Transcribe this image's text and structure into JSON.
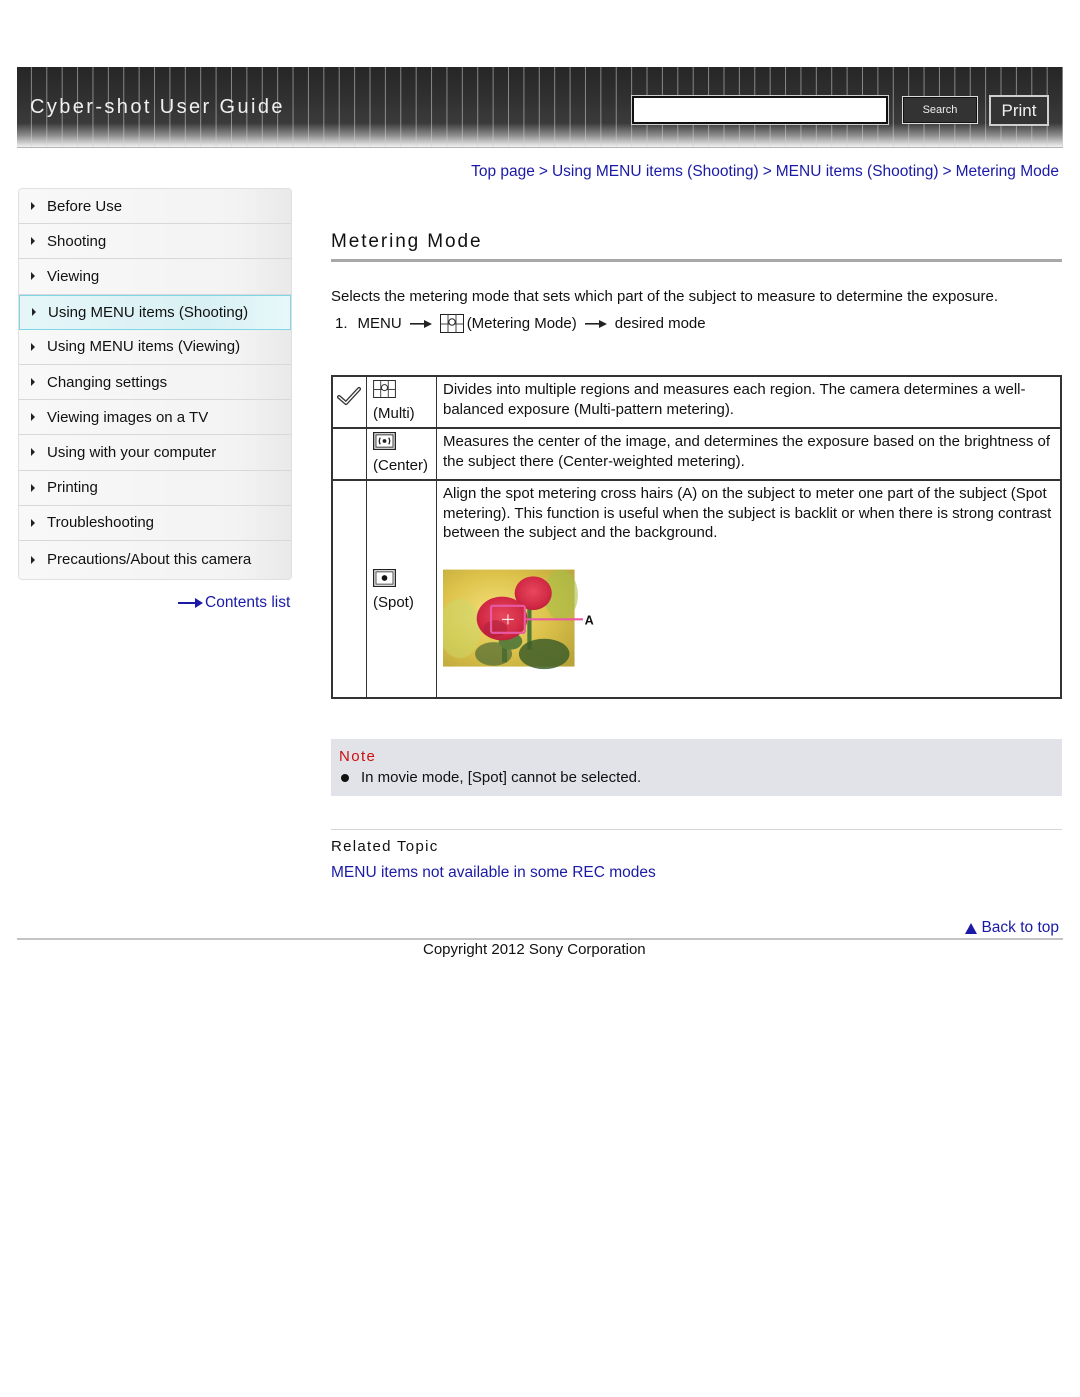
{
  "header": {
    "title": "Cyber-shot User Guide",
    "search": {
      "value": "",
      "placeholder": ""
    },
    "search_button": "Search",
    "print_button": "Print"
  },
  "breadcrumb": {
    "items": [
      "Top page",
      "Using MENU items (Shooting)",
      "MENU items (Shooting)",
      "Metering Mode"
    ],
    "separator": ">"
  },
  "sidebar": {
    "items": [
      {
        "label": "Before Use",
        "active": false
      },
      {
        "label": "Shooting",
        "active": false
      },
      {
        "label": "Viewing",
        "active": false
      },
      {
        "label": "Using MENU items (Shooting)",
        "active": true
      },
      {
        "label": "Using MENU items (Viewing)",
        "active": false
      },
      {
        "label": "Changing settings",
        "active": false
      },
      {
        "label": "Viewing images on a TV",
        "active": false
      },
      {
        "label": "Using with your computer",
        "active": false
      },
      {
        "label": "Printing",
        "active": false
      },
      {
        "label": "Troubleshooting",
        "active": false
      },
      {
        "label": "Precautions/About this camera",
        "active": false
      }
    ],
    "contents_link": "Contents list"
  },
  "main": {
    "title": "Metering Mode",
    "intro": "Selects the metering mode that sets which part of the subject to measure to determine the exposure.",
    "step": {
      "number": "1.",
      "menu": "MENU",
      "icon": "multi-metering-icon",
      "item": "(Metering Mode)",
      "target": "desired mode"
    },
    "modes": [
      {
        "default": true,
        "icon": "multi-metering-icon",
        "name": "(Multi)",
        "description": "Divides into multiple regions and measures each region. The camera determines a well-balanced exposure (Multi-pattern metering)."
      },
      {
        "default": false,
        "icon": "center-metering-icon",
        "name": "(Center)",
        "description": "Measures the center of the image, and determines the exposure based on the brightness of the subject there (Center-weighted metering)."
      },
      {
        "default": false,
        "icon": "spot-metering-icon",
        "name": "(Spot)",
        "description": "Align the spot metering cross hairs (A) on the subject to meter one part of the subject (Spot metering). This function is useful when the subject is backlit or when there is strong contrast between the subject and the background.",
        "illustration_label": "A"
      }
    ],
    "note": {
      "title": "Note",
      "items": [
        "In movie mode, [Spot] cannot be selected."
      ]
    },
    "related": {
      "title": "Related Topic",
      "links": [
        "MENU items not available in some REC modes"
      ]
    },
    "back_to_top": "Back to top"
  },
  "footer": {
    "copyright": "Copyright 2012 Sony Corporation"
  },
  "colors": {
    "link": "#1a1aa6",
    "note_title": "#cc1010",
    "note_bg": "#e1e3e8",
    "active_nav_border": "#7fd6e6",
    "header_bg": "#333333"
  }
}
